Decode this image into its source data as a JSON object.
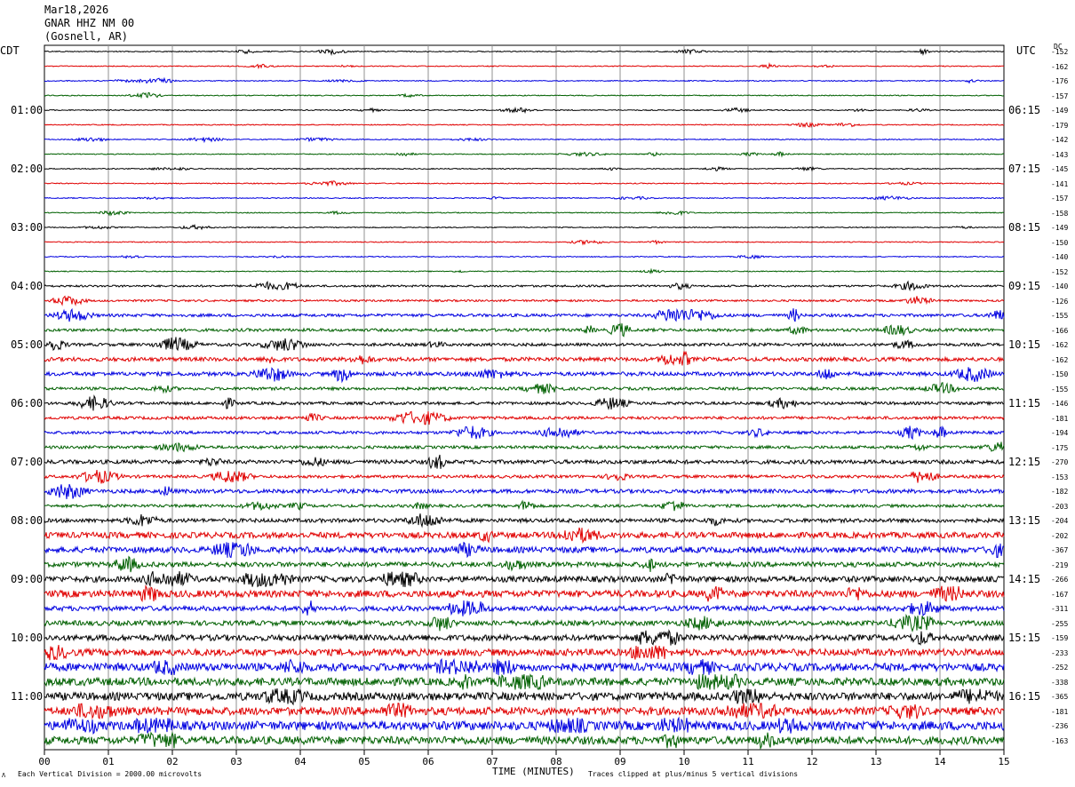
{
  "header": {
    "date": "Mar18,2026",
    "station": "GNAR HHZ NM 00",
    "location": "(Gosnell, AR)"
  },
  "left_axis_label": "CDT",
  "right_axis_label": "UTC",
  "dc_label": "DC",
  "left_hour_labels": [
    "01:00",
    "02:00",
    "03:00",
    "04:00",
    "05:00",
    "06:00",
    "07:00",
    "08:00",
    "09:00",
    "10:00",
    "11:00"
  ],
  "right_hour_labels": [
    "06:15",
    "07:15",
    "08:15",
    "09:15",
    "10:15",
    "11:15",
    "12:15",
    "13:15",
    "14:15",
    "15:15",
    "16:15"
  ],
  "dc_values": [
    "-152",
    "-162",
    "-176",
    "-157",
    "-149",
    "-179",
    "-142",
    "-143",
    "-145",
    "-141",
    "-157",
    "-158",
    "-149",
    "-150",
    "-140",
    "-152",
    "-140",
    "-126",
    "-155",
    "-166",
    "-162",
    "-162",
    "-150",
    "-155",
    "-146",
    "-181",
    "-194",
    "-175",
    "-270",
    "-153",
    "-182",
    "-203",
    "-204",
    "-202",
    "-367",
    "-219",
    "-266",
    "-167",
    "-311",
    "-255",
    "-159",
    "-233",
    "-252",
    "-338",
    "-365",
    "-181",
    "-236",
    "-163"
  ],
  "x_ticks": [
    "00",
    "01",
    "02",
    "03",
    "04",
    "05",
    "06",
    "07",
    "08",
    "09",
    "10",
    "11",
    "12",
    "13",
    "14",
    "15"
  ],
  "x_axis_title": "TIME (MINUTES)",
  "footer_left": "Each Vertical Division = 2000.00 microvolts",
  "footer_right": "Traces clipped at plus/minus 5 vertical divisions",
  "footer_mark": "Λ",
  "trace_colors": [
    "#000000",
    "#e00000",
    "#0000e0",
    "#006000"
  ],
  "trace_amplitudes": [
    1,
    1,
    1,
    1,
    1,
    1,
    1,
    1,
    1,
    1,
    1,
    1,
    1,
    1,
    1,
    1,
    2,
    2,
    3,
    3,
    3,
    4,
    4,
    3,
    3,
    3,
    3,
    3,
    4,
    3,
    4,
    3,
    4,
    6,
    6,
    5,
    6,
    7,
    5,
    5,
    6,
    7,
    8,
    8,
    8,
    8,
    9,
    8
  ]
}
